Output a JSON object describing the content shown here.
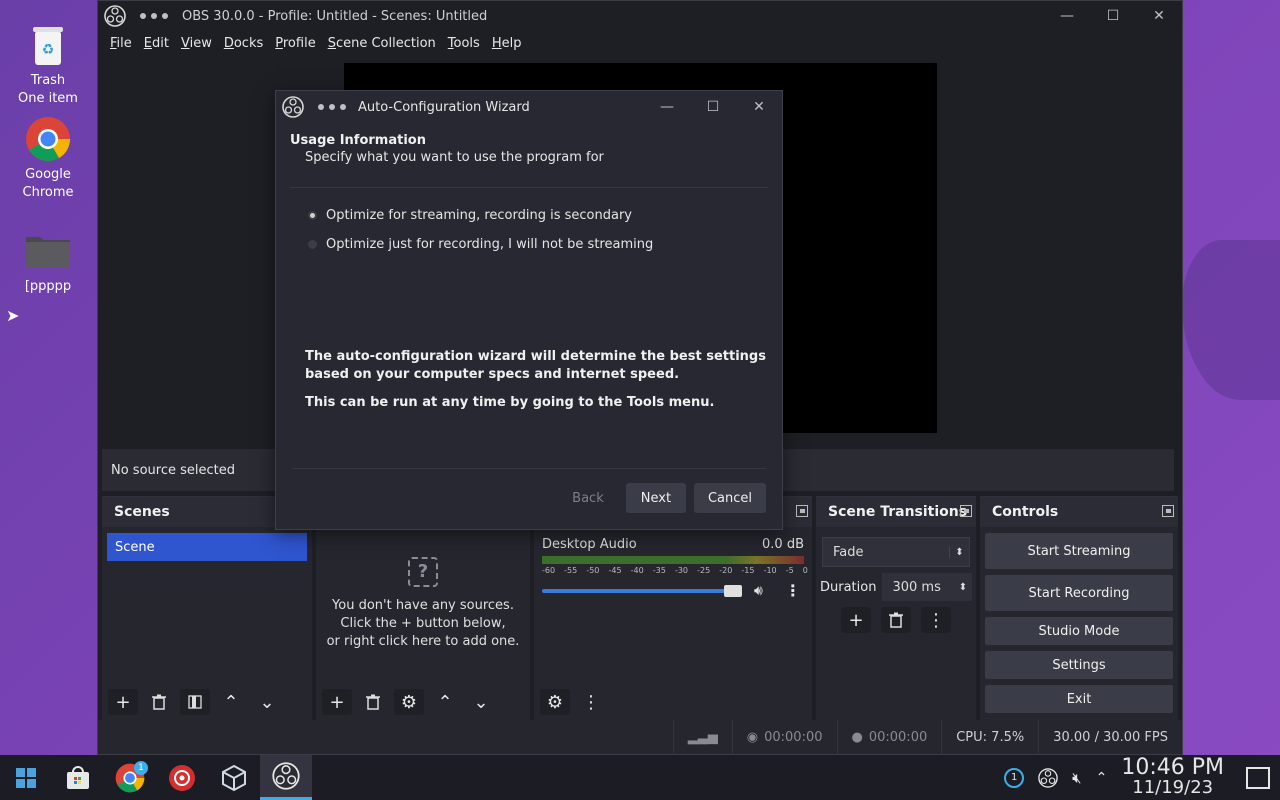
{
  "desktop": {
    "icons": [
      {
        "label1": "Trash",
        "label2": "One item"
      },
      {
        "label1": "Google",
        "label2": "Chrome"
      },
      {
        "label1": "[ppppp",
        "label2": ""
      }
    ]
  },
  "obs": {
    "title": "OBS 30.0.0 - Profile: Untitled - Scenes: Untitled",
    "menu": [
      "File",
      "Edit",
      "View",
      "Docks",
      "Profile",
      "Scene Collection",
      "Tools",
      "Help"
    ],
    "source_bar": "No source selected",
    "docks": {
      "scenes": {
        "title": "Scenes",
        "items": [
          "Scene"
        ]
      },
      "sources": {
        "empty_lines": [
          "You don't have any sources.",
          "Click the + button below,",
          "or right click here to add one."
        ]
      },
      "mixer": {
        "channel": "Desktop Audio",
        "level": "0.0 dB",
        "scale": [
          "-60",
          "-55",
          "-50",
          "-45",
          "-40",
          "-35",
          "-30",
          "-25",
          "-20",
          "-15",
          "-10",
          "-5",
          "0"
        ]
      },
      "transitions": {
        "title": "Scene Transitions",
        "selected": "Fade",
        "duration_label": "Duration",
        "duration_value": "300 ms"
      },
      "controls": {
        "title": "Controls",
        "buttons": [
          "Start Streaming",
          "Start Recording",
          "Studio Mode",
          "Settings",
          "Exit"
        ]
      }
    },
    "status": {
      "stream_time": "00:00:00",
      "rec_time": "00:00:00",
      "cpu": "CPU: 7.5%",
      "fps": "30.00 / 30.00 FPS"
    }
  },
  "wizard": {
    "title": "Auto-Configuration Wizard",
    "heading": "Usage Information",
    "subheading": "Specify what you want to use the program for",
    "options": [
      {
        "label": "Optimize for streaming, recording is secondary",
        "selected": true
      },
      {
        "label": "Optimize just for recording, I will not be streaming",
        "selected": false
      }
    ],
    "note1": "The auto-configuration wizard will determine the best settings based on your computer specs and internet speed.",
    "note2": "This can be run at any time by going to the Tools menu.",
    "buttons": {
      "back": "Back",
      "next": "Next",
      "cancel": "Cancel"
    }
  },
  "taskbar": {
    "chrome_badge": "1",
    "tray_badge": "1",
    "time": "10:46 PM",
    "date": "11/19/23"
  }
}
